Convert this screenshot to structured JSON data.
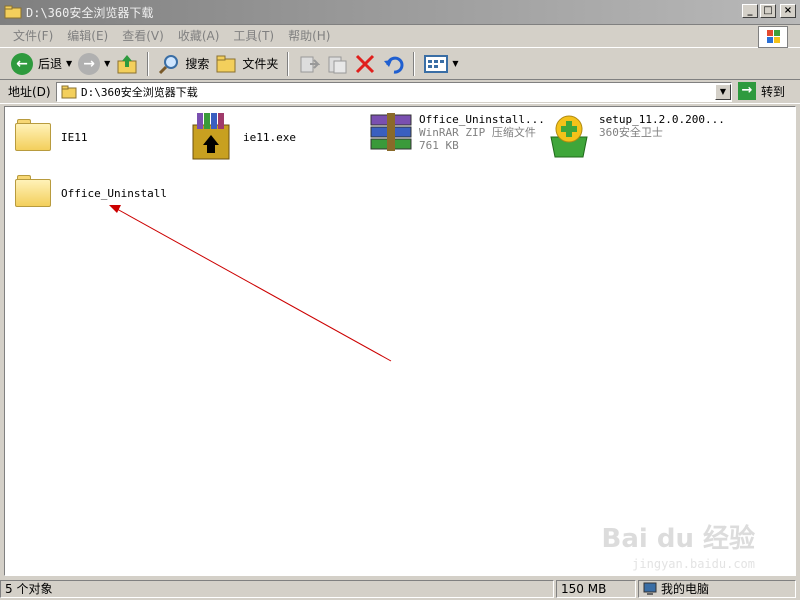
{
  "window": {
    "title": "D:\\360安全浏览器下载",
    "controls": [
      "_",
      "□",
      "×"
    ]
  },
  "menu": [
    "文件(F)",
    "编辑(E)",
    "查看(V)",
    "收藏(A)",
    "工具(T)",
    "帮助(H)"
  ],
  "toolbar": {
    "back_label": "后退",
    "search_label": "搜索",
    "folders_label": "文件夹"
  },
  "address": {
    "label": "地址(D)",
    "value": "D:\\360安全浏览器下载",
    "go_label": "转到"
  },
  "files": [
    {
      "name": "IE11",
      "type": "folder"
    },
    {
      "name": "ie11.exe",
      "type": "exe"
    },
    {
      "name": "Office_Uninstall...",
      "type": "zip",
      "desc": "WinRAR ZIP 压缩文件",
      "size": "761 KB"
    },
    {
      "name": "setup_11.2.0.200...",
      "type": "installer",
      "desc": "360安全卫士"
    },
    {
      "name": "Office_Uninstall",
      "type": "folder"
    }
  ],
  "watermark": {
    "brand": "Bai du 经验",
    "url": "jingyan.baidu.com"
  },
  "status": {
    "count": "5 个对象",
    "size": "150 MB",
    "location": "我的电脑"
  },
  "colors": {
    "annotation_arrow": "#cc0000",
    "go_green": "#2e9a3e"
  }
}
